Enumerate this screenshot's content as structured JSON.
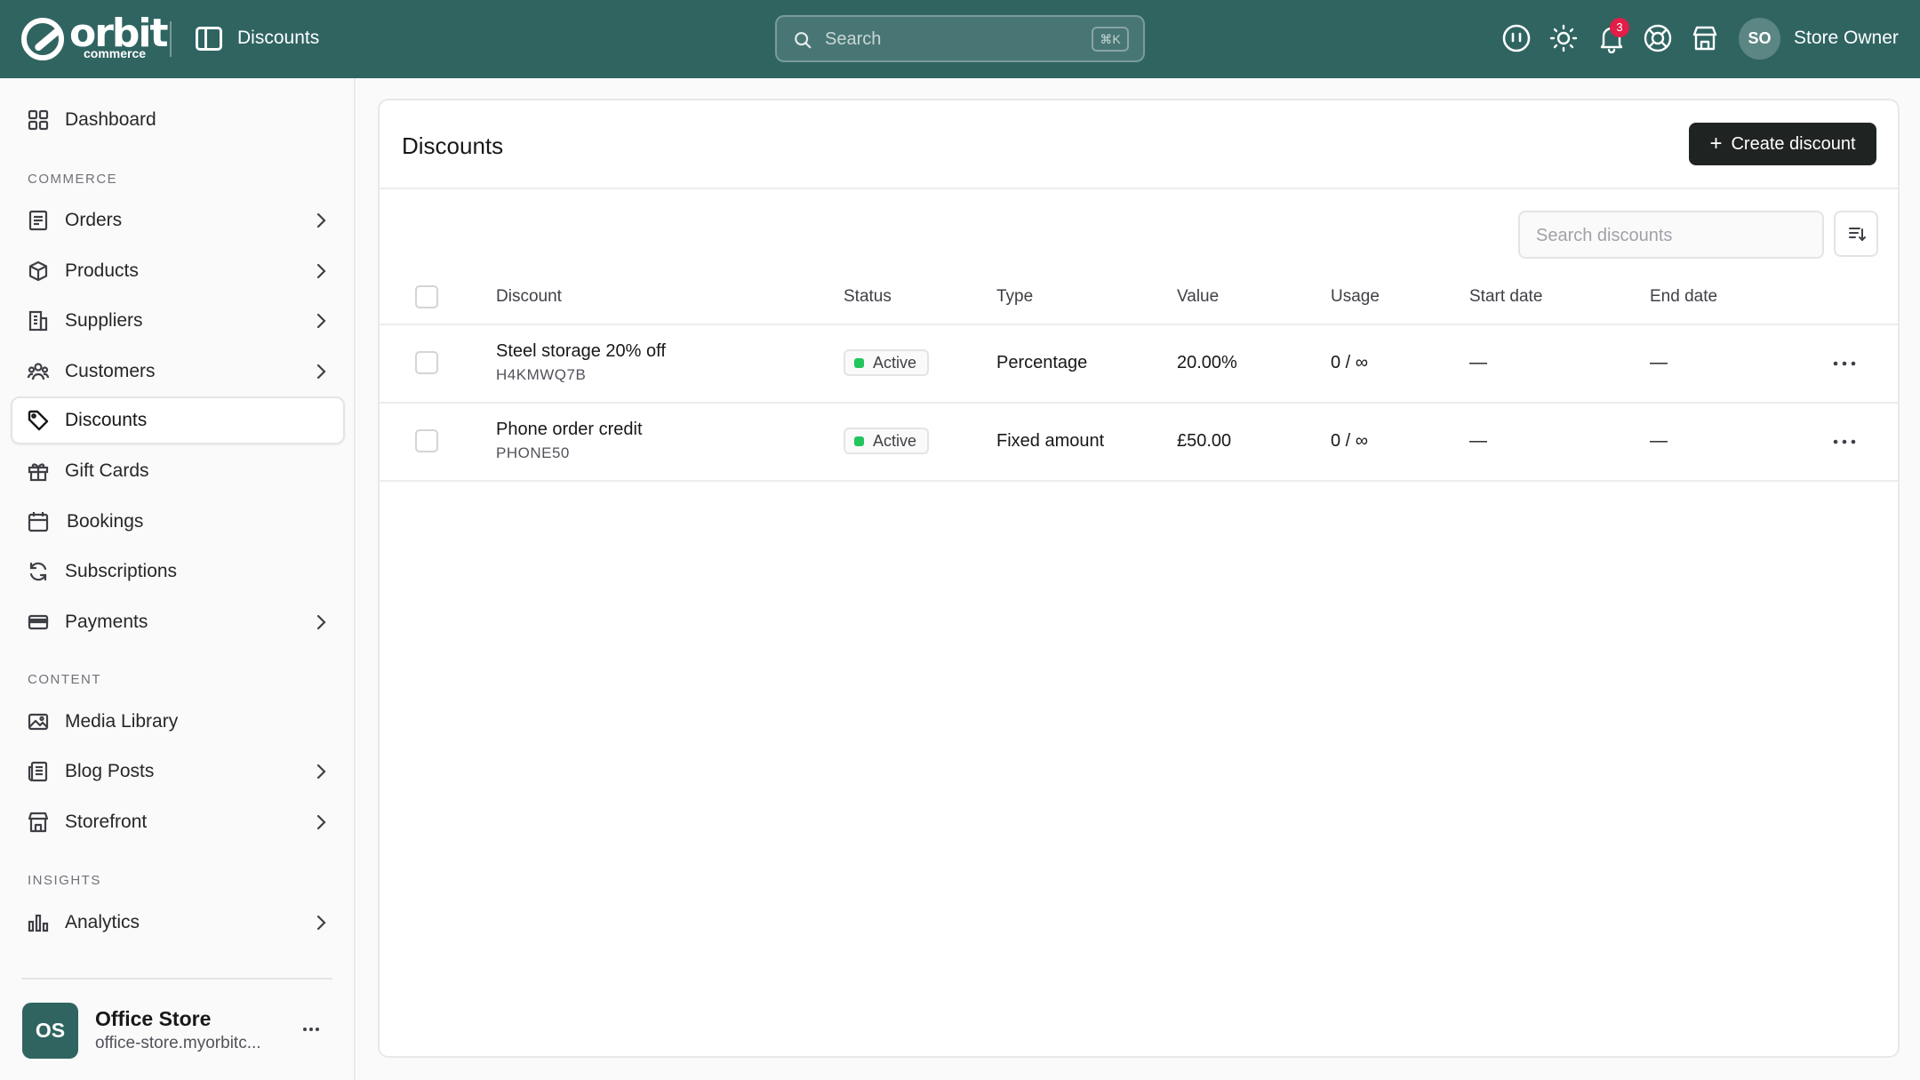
{
  "header": {
    "brand_name": "orbit",
    "brand_sub": "commerce",
    "page_title": "Discounts",
    "search_placeholder": "Search",
    "search_shortcut": "⌘K",
    "notification_count": "3",
    "user_initials": "SO",
    "user_name": "Store Owner",
    "icons": [
      "ai-assistant-icon",
      "theme-sun-icon",
      "bell-icon",
      "help-lifebuoy-icon",
      "storefront-icon"
    ]
  },
  "sidebar": {
    "dashboard": "Dashboard",
    "sections": {
      "commerce": "COMMERCE",
      "content": "CONTENT",
      "insights": "INSIGHTS"
    },
    "items": {
      "orders": "Orders",
      "products": "Products",
      "suppliers": "Suppliers",
      "customers": "Customers",
      "discounts": "Discounts",
      "gift_cards": "Gift Cards",
      "bookings": "Bookings",
      "subscriptions": "Subscriptions",
      "payments": "Payments",
      "media_library": "Media Library",
      "blog_posts": "Blog Posts",
      "storefront": "Storefront",
      "analytics": "Analytics"
    },
    "active_item": "Discounts",
    "store": {
      "initials": "OS",
      "name": "Office Store",
      "url": "office-store.myorbitc..."
    }
  },
  "main": {
    "title": "Discounts",
    "create_button": "Create discount",
    "search_placeholder": "Search discounts",
    "columns": [
      "Discount",
      "Status",
      "Type",
      "Value",
      "Usage",
      "Start date",
      "End date"
    ],
    "rows": [
      {
        "name": "Steel storage 20% off",
        "code": "H4KMWQ7B",
        "status": "Active",
        "type": "Percentage",
        "value": "20.00%",
        "usage": "0 / ∞",
        "start_date": "—",
        "end_date": "—"
      },
      {
        "name": "Phone order credit",
        "code": "PHONE50",
        "status": "Active",
        "type": "Fixed amount",
        "value": "£50.00",
        "usage": "0 / ∞",
        "start_date": "—",
        "end_date": "—"
      }
    ]
  },
  "colors": {
    "topbar": "#2f6461",
    "primary_button": "#1f2322",
    "status_active": "#22c55e",
    "badge": "#e11d48"
  }
}
